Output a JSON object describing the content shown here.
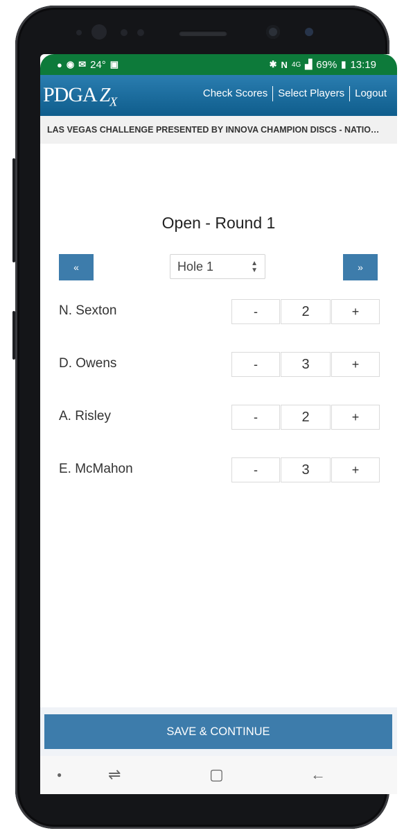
{
  "status_bar": {
    "left_icons": [
      "chat-icon",
      "messenger-icon",
      "mail-icon"
    ],
    "temperature": "24°",
    "right_icons": [
      "bluetooth-icon",
      "nfc-icon",
      "lte-icon",
      "signal-icon"
    ],
    "network": "4G",
    "battery_percent": "69%",
    "time": "13:19"
  },
  "header": {
    "logo_main": "PDGA",
    "logo_zx": "Z",
    "logo_sub": "X",
    "nav": [
      "Check Scores",
      "Select Players",
      "Logout"
    ]
  },
  "event": {
    "title": "LAS VEGAS CHALLENGE PRESENTED BY INNOVA CHAMPION DISCS - NATIO…"
  },
  "round": {
    "title": "Open - Round 1",
    "prev_label": "«",
    "next_label": "»",
    "hole_selected": "Hole 1"
  },
  "players": [
    {
      "name": "N. Sexton",
      "score": "2"
    },
    {
      "name": "D. Owens",
      "score": "3"
    },
    {
      "name": "A. Risley",
      "score": "2"
    },
    {
      "name": "E. McMahon",
      "score": "3"
    }
  ],
  "stepper": {
    "minus": "-",
    "plus": "+"
  },
  "save_label": "SAVE & CONTINUE",
  "colors": {
    "status_bar": "#0d7a3a",
    "header": "#0f5d8c",
    "accent": "#3d7cab"
  }
}
